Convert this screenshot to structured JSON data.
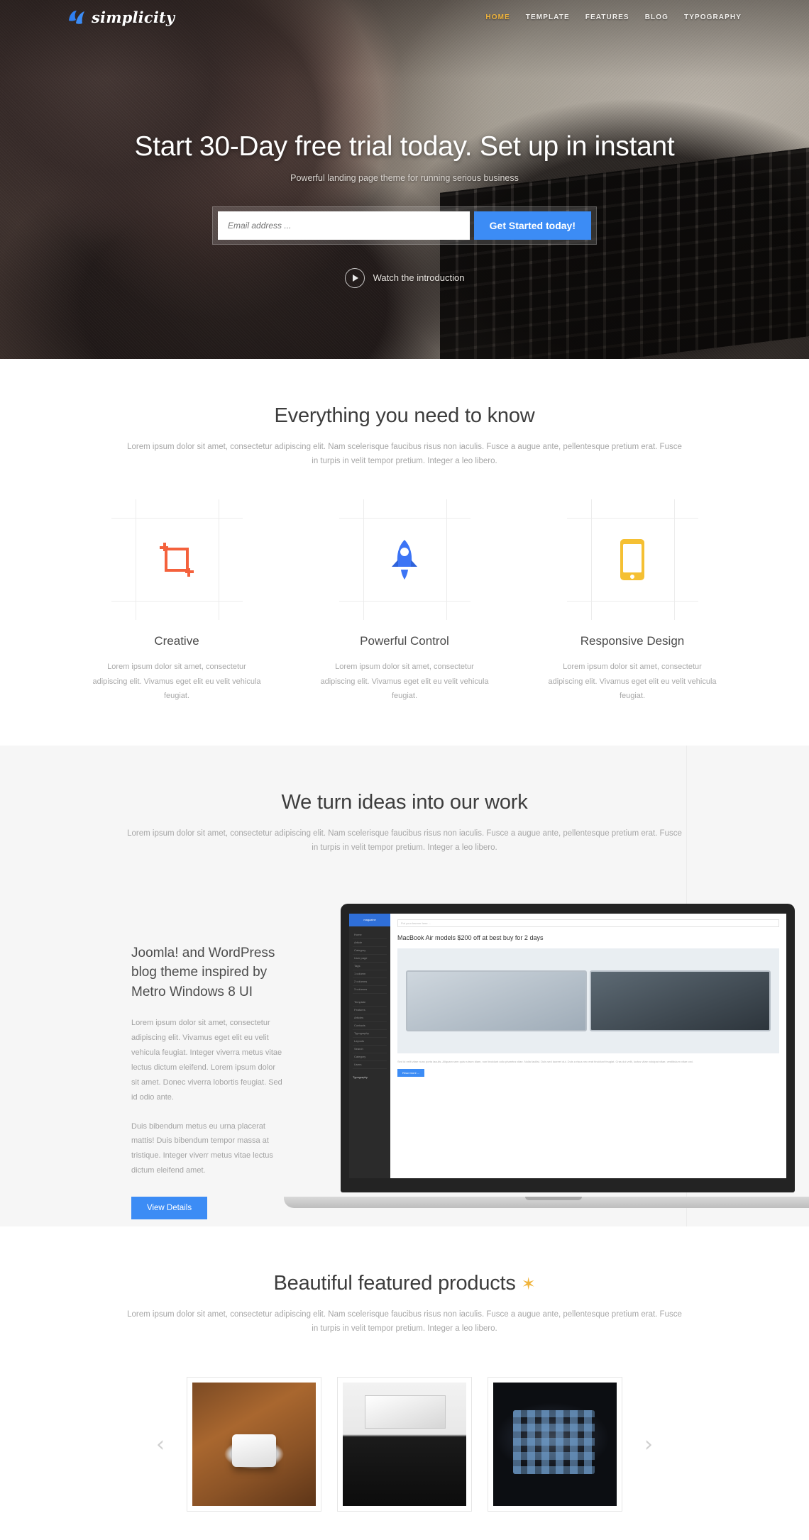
{
  "header": {
    "logo_text": "simplicity",
    "logo_icon": "simplicity-leaf-mark",
    "nav": [
      {
        "label": "HOME",
        "active": true
      },
      {
        "label": "TEMPLATE",
        "active": false
      },
      {
        "label": "FEATURES",
        "active": false
      },
      {
        "label": "BLOG",
        "active": false
      },
      {
        "label": "TYPOGRAPHY",
        "active": false
      }
    ]
  },
  "hero": {
    "title": "Start 30-Day free trial today. Set up in instant",
    "subtitle": "Powerful landing page theme for running serious business",
    "email_placeholder": "Email address ...",
    "email_value": "",
    "cta_label": "Get Started today!",
    "watch_label": "Watch the introduction",
    "play_icon": "play-icon"
  },
  "features": {
    "title": "Everything you need to know",
    "description": "Lorem ipsum dolor sit amet, consectetur adipiscing elit. Nam scelerisque faucibus risus non iaculis. Fusce a augue ante, pellentesque pretium erat. Fusce in turpis in velit tempor pretium. Integer a leo libero.",
    "cards": [
      {
        "icon": "crop-tool-icon",
        "icon_color": "#f4613c",
        "title": "Creative",
        "text": "Lorem ipsum dolor sit amet, consectetur adipiscing elit. Vivamus eget elit eu velit vehicula feugiat."
      },
      {
        "icon": "rocket-icon",
        "icon_color": "#3c74f5",
        "title": "Powerful Control",
        "text": "Lorem ipsum dolor sit amet, consectetur adipiscing elit. Vivamus eget elit eu velit vehicula feugiat."
      },
      {
        "icon": "mobile-phone-icon",
        "icon_color": "#f5c033",
        "title": "Responsive Design",
        "text": "Lorem ipsum dolor sit amet, consectetur adipiscing elit. Vivamus eget elit eu velit vehicula feugiat."
      }
    ]
  },
  "portfolio": {
    "title": "We turn ideas into our work",
    "description": "Lorem ipsum dolor sit amet, consectetur adipiscing elit. Nam scelerisque faucibus risus non iaculis. Fusce a augue ante, pellentesque pretium erat. Fusce in turpis in velit tempor pretium. Integer a leo libero.",
    "item_title": "Joomla! and WordPress blog theme inspired by Metro Windows 8 UI",
    "item_p1": "Lorem ipsum dolor sit amet, consectetur adipiscing elit. Vivamus eget elit eu velit vehicula feugiat. Integer viverra metus vitae lectus dictum eleifend. Lorem ipsum dolor sit amet. Donec viverra lobortis feugiat. Sed id odio ante.",
    "item_p2": "Duis bibendum metus eu urna placerat mattis! Duis bibendum tempor massa at tristique. Integer viverr metus vitae lectus dictum eleifend amet.",
    "button_label": "View Details",
    "mock": {
      "brand": "magazine",
      "search_placeholder": "Put your banner here ...",
      "headline": "MacBook Air models $200 off at best buy for 2 days",
      "nav_items": [
        "Home",
        "Article",
        "Category",
        "User page",
        "Tags",
        "1 column",
        "2 columns",
        "3 columns"
      ],
      "nav_items2": [
        "Template",
        "Features",
        "Articles",
        "Contacts",
        "Typography",
        "Layouts",
        "Search",
        "Category",
        "Users"
      ],
      "nav_section": "Typography",
      "body_text": "Sed id velit vitae nunc porta iaculis. Aliquam sem quis rutrum diam, non tincidunt odio pharetra vitae. Nulla facilisi. Duis sed laoreet dui. Duis a risus nec erat tincidunt feugiat. Cras dui velit, luctus vitae volutpat vitae, vestibulum vitae orci.",
      "read_more": "Read more ..."
    }
  },
  "products": {
    "title": "Beautiful featured products",
    "title_star": "✶",
    "description": "Lorem ipsum dolor sit amet, consectetur adipiscing elit. Nam scelerisque faucibus risus non iaculis. Fusce a augue ante, pellentesque pretium erat. Fusce in turpis in velit tempor pretium. Integer a leo libero.",
    "prev_icon": "chevron-left-icon",
    "next_icon": "chevron-right-icon",
    "slides": [
      {
        "name": "wireless-router-product-image"
      },
      {
        "name": "imac-desktop-product-image"
      },
      {
        "name": "smartphone-product-image"
      }
    ]
  },
  "colors": {
    "accent_blue": "#3c8cf5",
    "accent_gold": "#f0b43c",
    "orange": "#f4613c",
    "yellow": "#f5c033"
  }
}
